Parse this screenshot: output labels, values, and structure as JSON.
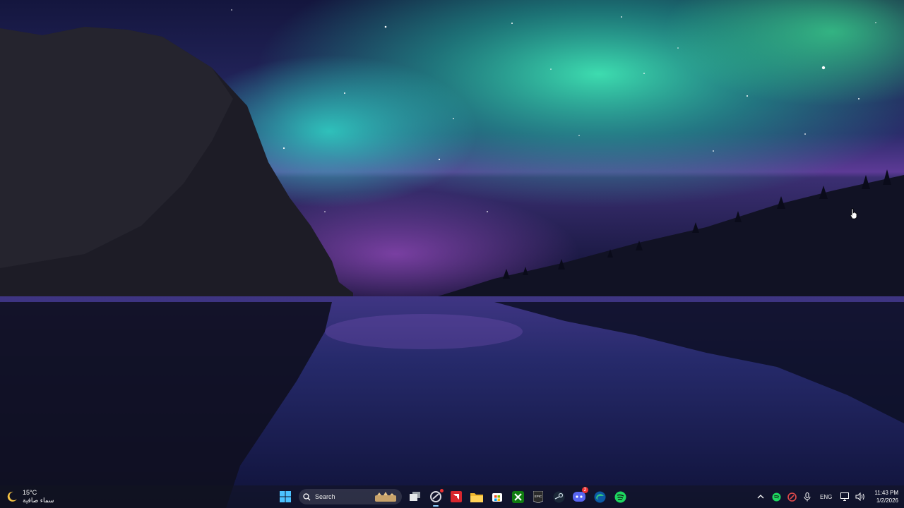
{
  "weather": {
    "temperature": "15°C",
    "condition": "سماء صافية",
    "icon": "moon-icon"
  },
  "taskbar": {
    "search_label": "Search",
    "apps": [
      {
        "name": "start-button",
        "icon": "windows-logo-icon"
      },
      {
        "name": "task-view",
        "icon": "task-view-icon"
      },
      {
        "name": "chrome-like-app",
        "icon": "circle-app-icon",
        "active": true
      },
      {
        "name": "amd-software",
        "icon": "amd-icon"
      },
      {
        "name": "file-explorer",
        "icon": "folder-icon"
      },
      {
        "name": "microsoft-store",
        "icon": "store-icon"
      },
      {
        "name": "xbox",
        "icon": "xbox-icon"
      },
      {
        "name": "epic-games",
        "icon": "epic-games-icon",
        "text": "EPIC"
      },
      {
        "name": "steam",
        "icon": "steam-icon"
      },
      {
        "name": "discord",
        "icon": "discord-icon",
        "badge": "2"
      },
      {
        "name": "edge",
        "icon": "edge-icon"
      },
      {
        "name": "spotify",
        "icon": "spotify-icon"
      }
    ]
  },
  "tray": {
    "language": "ENG",
    "time": "11:43 PM",
    "date": "1/2/2026"
  },
  "colors": {
    "aurora_green": "#2de0b0",
    "aurora_purple": "#7a3fb0",
    "sky_deep": "#0d1035",
    "water": "#1a1d55",
    "spotify_green": "#1ed760",
    "accent_blue": "#8fd0ff"
  }
}
